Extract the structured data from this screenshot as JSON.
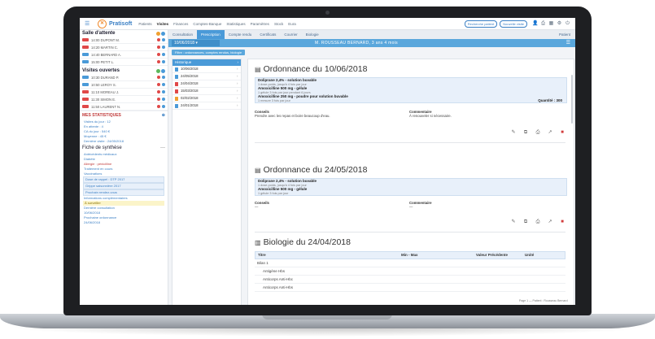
{
  "nav": {
    "logo": "Pratisoft",
    "items": [
      "Patients",
      "Visites",
      "Finances",
      "Comptes-Banque",
      "Statistiques",
      "Paramètres",
      "Stock",
      "Eura"
    ],
    "active_index": 1,
    "pill_1": "Recherche patient",
    "pill_2": "Nouvelle visite"
  },
  "left": {
    "waiting_title": "Salle d'attente",
    "waiting_rows": [
      {
        "text": "14:00 DUPONT M.",
        "tag_color": "#e04848"
      },
      {
        "text": "14:20 MARTIN C.",
        "tag_color": "#e04848"
      },
      {
        "text": "14:40 BERNARD A.",
        "tag_color": "#4a9ad8"
      },
      {
        "text": "15:00 PETIT L.",
        "tag_color": "#4a9ad8"
      }
    ],
    "open_title": "Visites ouvertes",
    "open_rows": [
      {
        "text": "10:30 DURAND P.",
        "tag_color": "#4a9ad8"
      },
      {
        "text": "10:50 LEROY S.",
        "tag_color": "#4a9ad8"
      },
      {
        "text": "11:10 MOREAU J.",
        "tag_color": "#e04848"
      },
      {
        "text": "11:30 SIMON E.",
        "tag_color": "#e04848"
      },
      {
        "text": "11:50 LAURENT N.",
        "tag_color": "#e04848"
      }
    ],
    "stats_title": "MES STATISTIQUES",
    "stats_lines": [
      "Visites du jour : 12",
      "En attente : 4",
      "CA du jour : 540 €",
      "Moyenne : 45 €",
      "Dernière visite : 24/05/2018"
    ],
    "history_title": "Fiche de synthèse",
    "history_lines": [
      {
        "text": "Antécédents médicaux",
        "style": ""
      },
      {
        "text": "Diabète",
        "style": ""
      },
      {
        "text": "Allergie : pénicilline",
        "style": "red"
      },
      {
        "text": "Traitement en cours",
        "style": ""
      },
      {
        "text": "Vaccinations",
        "style": ""
      },
      {
        "text": "Dose de rappel : DTP 2017",
        "style": "box"
      },
      {
        "text": "Grippe saisonnière 2017",
        "style": "box"
      },
      {
        "text": "Prochain rendez-vous",
        "style": "box"
      },
      {
        "text": "Informations complémentaires",
        "style": ""
      },
      {
        "text": "À surveiller",
        "style": "yellow"
      },
      {
        "text": "Dernière consultation",
        "style": ""
      },
      {
        "text": "10/06/2018",
        "style": ""
      },
      {
        "text": "Prochaine ordonnance",
        "style": ""
      },
      {
        "text": "24/06/2018",
        "style": ""
      }
    ]
  },
  "tabs": {
    "items": [
      "Consultation",
      "Prescription",
      "Compte rendu",
      "Certificats",
      "Courrier",
      "Biologie"
    ],
    "active_index": 1,
    "right": "Patient"
  },
  "datebar": {
    "date": "10/06/2018",
    "patient": "M. ROUSSEAU BERNARD, 3 ans 4 mois"
  },
  "filter": {
    "chip": "Filtre : ordonnances, comptes rendus, biologie"
  },
  "doclist": {
    "header": "Historique",
    "rows": [
      {
        "date": "10/06/2018",
        "color": "#4a9ad8"
      },
      {
        "date": "24/05/2018",
        "color": "#4a9ad8"
      },
      {
        "date": "24/04/2018",
        "color": "#e04848"
      },
      {
        "date": "15/03/2018",
        "color": "#e04848"
      },
      {
        "date": "02/02/2018",
        "color": "#f0a030"
      },
      {
        "date": "24/01/2018",
        "color": "#4a9ad8"
      }
    ]
  },
  "rx1": {
    "title": "Ordonnance du 10/06/2018",
    "meds": [
      {
        "name": "Doliprane 2,4% - solution buvable",
        "sub": "1 dose-poids, jusqu'à 4 fois par jour"
      },
      {
        "name": "Amoxicilline 500 mg - gélule",
        "sub": "1 gélule 3 fois par jour pendant 6 jours"
      },
      {
        "name": "Amoxicilline 250 mg - poudre pour solution buvable",
        "sub": "1 mesure 3 fois par jour"
      }
    ],
    "right_note": "Quantité : 300",
    "notes_label": "Conseils",
    "notes_text": "Prendre avec les repas et boire beaucoup d'eau.",
    "second_label": "Commentaire",
    "second_text": "À renouveler si nécessaire."
  },
  "rx2": {
    "title": "Ordonnance du 24/05/2018",
    "meds": [
      {
        "name": "Doliprane 2,4% - solution buvable",
        "sub": "1 dose-poids, jusqu'à 4 fois par jour"
      },
      {
        "name": "Amoxicilline 500 mg - gélule",
        "sub": "1 gélule 3 fois par jour"
      }
    ],
    "notes_label": "Conseils",
    "notes_text": "—",
    "second_label": "Commentaire",
    "second_text": "—"
  },
  "bio": {
    "title": "Biologie du 24/04/2018",
    "headers": [
      "Titre",
      "Min - Max",
      "Valeur Précédente",
      "Unité"
    ],
    "rows": [
      "Bilan 1",
      "Antigène Hbs",
      "Anticorps Anti-Hbc",
      "Anticorps Anti-Hbs"
    ]
  },
  "status": "Page 1 — Patient : Rousseau Bernard",
  "colors": {
    "accent": "#4a9ad8",
    "danger": "#d23b3b",
    "brand_orange": "#f08a2c"
  }
}
